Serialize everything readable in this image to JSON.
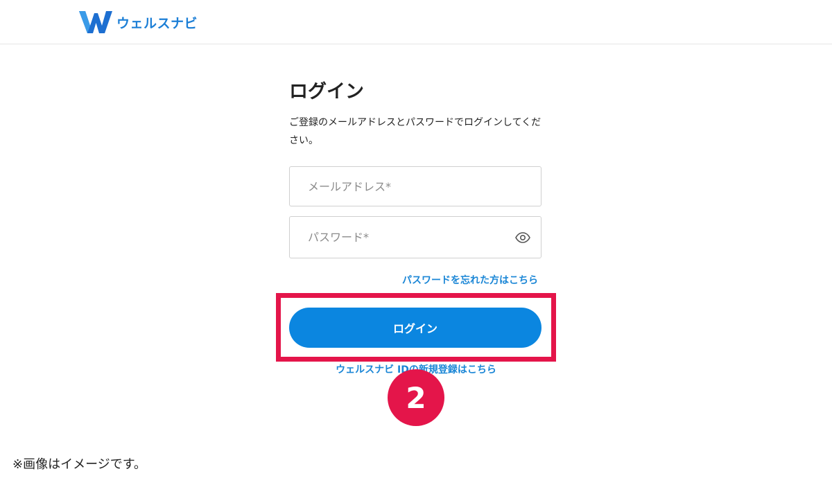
{
  "header": {
    "logo_text": "ウェルスナビ",
    "brand_color": "#1d7fd6"
  },
  "login": {
    "title": "ログイン",
    "description": "ご登録のメールアドレスとパスワードでログインしてください。",
    "email_placeholder": "メールアドレス*",
    "password_placeholder": "パスワード*",
    "eye_icon": "eye-icon",
    "forgot_link": "パスワードを忘れた方はこちら",
    "submit_label": "ログイン",
    "register_link": "ウェルスナビ IDの新規登録はこちら",
    "button_color": "#0b86e0",
    "link_color": "#1a86d6"
  },
  "annotation": {
    "step_number": "2",
    "highlight_color": "#e4154a"
  },
  "footer": {
    "note": "※画像はイメージです。"
  }
}
